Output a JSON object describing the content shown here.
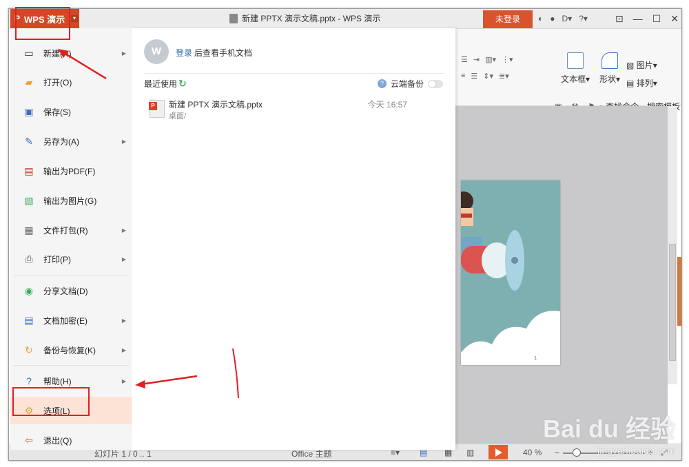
{
  "app": {
    "name": "WPS 演示",
    "logo": "P"
  },
  "title_bar": {
    "document_title": "新建 PPTX 演示文稿.pptx - WPS 演示",
    "login_button": "未登录",
    "help": "?"
  },
  "ribbon": {
    "textbox_label": "文本框",
    "shape_label": "形状",
    "picture_label": "图片",
    "arrange_label": "排列",
    "search_placeholder": "查找命令、搜索模板"
  },
  "menu": {
    "items": [
      {
        "label": "新建(N)",
        "icon": "new-doc-icon",
        "has_submenu": true
      },
      {
        "label": "打开(O)",
        "icon": "folder-open-icon",
        "has_submenu": false
      },
      {
        "label": "保存(S)",
        "icon": "save-icon",
        "has_submenu": false
      },
      {
        "label": "另存为(A)",
        "icon": "save-as-icon",
        "has_submenu": true
      },
      {
        "label": "输出为PDF(F)",
        "icon": "pdf-icon",
        "has_submenu": false
      },
      {
        "label": "输出为图片(G)",
        "icon": "image-export-icon",
        "has_submenu": false
      },
      {
        "label": "文件打包(R)",
        "icon": "package-icon",
        "has_submenu": true
      },
      {
        "label": "打印(P)",
        "icon": "printer-icon",
        "has_submenu": true
      },
      {
        "label": "分享文档(D)",
        "icon": "share-icon",
        "has_submenu": false
      },
      {
        "label": "文档加密(E)",
        "icon": "lock-doc-icon",
        "has_submenu": true
      },
      {
        "label": "备份与恢复(K)",
        "icon": "backup-icon",
        "has_submenu": true
      },
      {
        "label": "帮助(H)",
        "icon": "help-icon",
        "has_submenu": true
      },
      {
        "label": "选项(L)",
        "icon": "gear-icon",
        "has_submenu": false,
        "selected": true
      },
      {
        "label": "退出(Q)",
        "icon": "exit-icon",
        "has_submenu": false
      }
    ]
  },
  "panel": {
    "avatar_letter": "W",
    "login_link": "登录",
    "login_text": "后查看手机文档",
    "recent_heading": "最近使用",
    "cloud_backup_label": "云端备份",
    "cloud_backup_on": false,
    "recent_files": [
      {
        "name": "新建 PPTX 演示文稿.pptx",
        "path": "桌面/",
        "time": "今天 16:57"
      }
    ]
  },
  "status_bar": {
    "slide_info": "幻灯片 1 / 0 .. 1",
    "theme": "Office 主题",
    "zoom": "40 %"
  },
  "slide": {
    "page_number": "1"
  },
  "watermark": {
    "brand": "Bai du 经验",
    "url": "jingyan.baidu.com"
  },
  "colors": {
    "accent": "#d24726",
    "login": "#d9532e",
    "selected": "#fde3d6",
    "annotation": "#e02020"
  }
}
